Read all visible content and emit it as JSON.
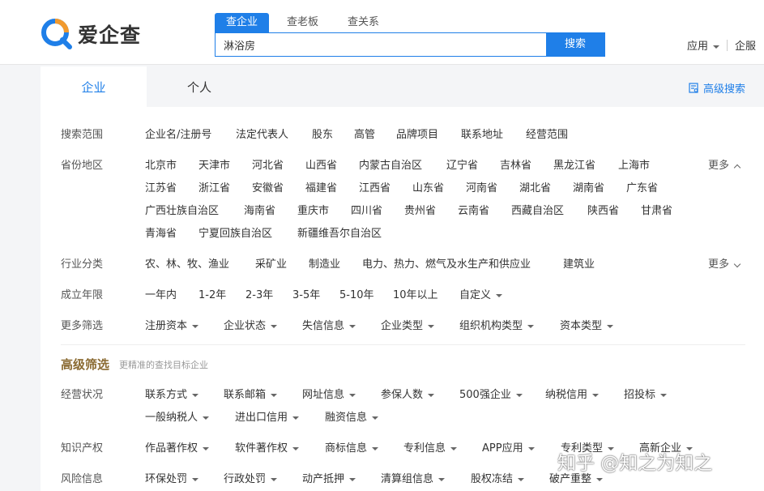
{
  "brand": {
    "name": "爱企查",
    "accent": "#1f7fe8",
    "logo_orange": "#f29a2e",
    "gold": "#8a6a31"
  },
  "search": {
    "tabs": [
      "查企业",
      "查老板",
      "查关系"
    ],
    "value": "淋浴房",
    "button": "搜索"
  },
  "header_nav": {
    "app": "应用",
    "service": "企服"
  },
  "content_tabs": [
    "企业",
    "个人"
  ],
  "advanced_search": "高级搜索",
  "filters": {
    "scope": {
      "label": "搜索范围",
      "options": [
        "企业名/注册号",
        "法定代表人",
        "股东",
        "高管",
        "品牌项目",
        "联系地址",
        "经营范围"
      ]
    },
    "province": {
      "label": "省份地区",
      "more": "更多",
      "row1": [
        "北京市",
        "天津市",
        "河北省",
        "山西省",
        "内蒙古自治区",
        "辽宁省",
        "吉林省",
        "黑龙江省",
        "上海市"
      ],
      "row2": [
        "江苏省",
        "浙江省",
        "安徽省",
        "福建省",
        "江西省",
        "山东省",
        "河南省",
        "湖北省",
        "湖南省",
        "广东省"
      ],
      "row3": [
        "广西壮族自治区",
        "海南省",
        "重庆市",
        "四川省",
        "贵州省",
        "云南省",
        "西藏自治区",
        "陕西省",
        "甘肃省"
      ],
      "row4": [
        "青海省",
        "宁夏回族自治区",
        "新疆维吾尔自治区"
      ]
    },
    "industry": {
      "label": "行业分类",
      "more": "更多",
      "options": [
        "农、林、牧、渔业",
        "采矿业",
        "制造业",
        "电力、热力、燃气及水生产和供应业",
        "建筑业"
      ]
    },
    "founded": {
      "label": "成立年限",
      "options": [
        "一年内",
        "1-2年",
        "2-3年",
        "3-5年",
        "5-10年",
        "10年以上",
        "自定义"
      ]
    },
    "more_filters": {
      "label": "更多筛选",
      "options": [
        "注册资本",
        "企业状态",
        "失信信息",
        "企业类型",
        "组织机构类型",
        "资本类型"
      ]
    }
  },
  "advanced": {
    "title": "高级筛选",
    "subtitle": "更精准的查找目标企业"
  },
  "adv_filters": {
    "operation": {
      "label": "经营状况",
      "row1": [
        "联系方式",
        "联系邮箱",
        "网址信息",
        "参保人数",
        "500强企业",
        "纳税信用",
        "招投标"
      ],
      "row2": [
        "一般纳税人",
        "进出口信用",
        "融资信息"
      ]
    },
    "ip": {
      "label": "知识产权",
      "options": [
        "作品著作权",
        "软件著作权",
        "商标信息",
        "专利信息",
        "APP应用",
        "专利类型",
        "高新企业"
      ]
    },
    "risk": {
      "label": "风险信息",
      "options": [
        "环保处罚",
        "行政处罚",
        "动产抵押",
        "清算组信息",
        "股权冻结",
        "破产重整"
      ]
    }
  },
  "watermark": "知乎 @知之为知之"
}
